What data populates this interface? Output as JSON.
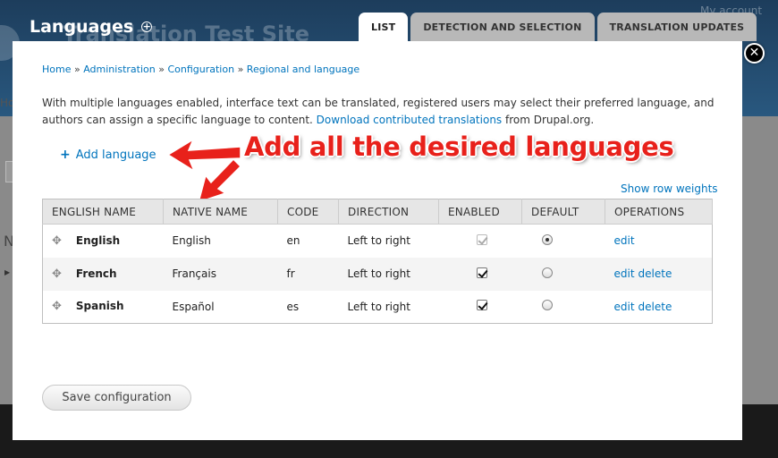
{
  "background": {
    "site_name": "Translation Test Site",
    "account": "My account",
    "home_fragment": "Ho",
    "n_fragment": "N"
  },
  "page": {
    "title": "Languages"
  },
  "tabs": [
    {
      "label": "LIST",
      "active": true
    },
    {
      "label": "DETECTION AND SELECTION",
      "active": false
    },
    {
      "label": "TRANSLATION UPDATES",
      "active": false
    }
  ],
  "breadcrumb": {
    "items": [
      "Home",
      "Administration",
      "Configuration",
      "Regional and language"
    ],
    "separator": "»"
  },
  "description": {
    "text": "With multiple languages enabled, interface text can be translated, registered users may select their preferred language, and authors can assign a specific language to content.",
    "link": "Download contributed translations",
    "suffix": "from Drupal.org."
  },
  "add_language": "Add language",
  "annotation": "Add all the desired languages",
  "show_row_weights": "Show row weights",
  "table": {
    "headers": [
      "ENGLISH NAME",
      "NATIVE NAME",
      "CODE",
      "DIRECTION",
      "ENABLED",
      "DEFAULT",
      "OPERATIONS"
    ],
    "rows": [
      {
        "english": "English",
        "native": "English",
        "code": "en",
        "direction": "Left to right",
        "enabled": true,
        "enabled_locked": true,
        "default": true,
        "ops": [
          "edit"
        ]
      },
      {
        "english": "French",
        "native": "Français",
        "code": "fr",
        "direction": "Left to right",
        "enabled": true,
        "enabled_locked": false,
        "default": false,
        "ops": [
          "edit",
          "delete"
        ]
      },
      {
        "english": "Spanish",
        "native": "Español",
        "code": "es",
        "direction": "Left to right",
        "enabled": true,
        "enabled_locked": false,
        "default": false,
        "ops": [
          "edit",
          "delete"
        ]
      }
    ]
  },
  "save_button": "Save configuration",
  "colors": {
    "link": "#0074bd",
    "annotation": "#e8211b",
    "header_bg": "#1d3d5c"
  }
}
